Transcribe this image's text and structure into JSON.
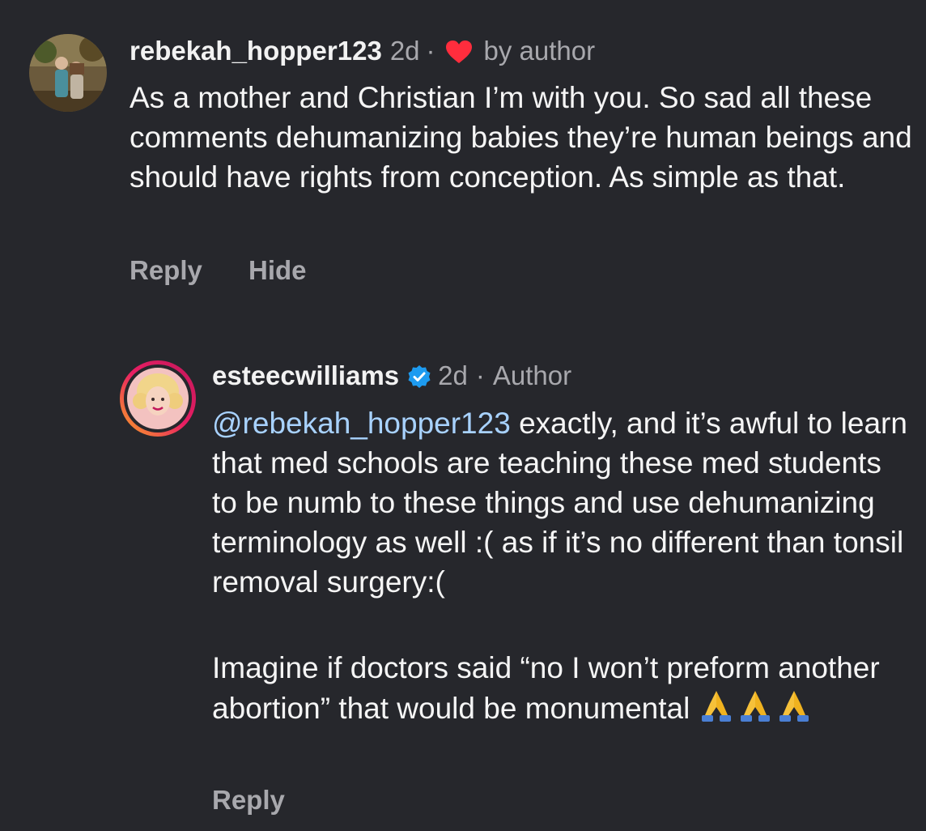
{
  "comment1": {
    "username": "rebekah_hopper123",
    "time": "2d",
    "sep": "·",
    "liked_label": "by author",
    "text": "As a mother and Christian I’m with you. So sad all these comments dehumanizing babies they’re human beings and should have rights from conception. As simple as that.",
    "reply_label": "Reply",
    "hide_label": "Hide"
  },
  "comment2": {
    "username": "esteecwilliams",
    "time": "2d",
    "sep": "·",
    "role": "Author",
    "mention": "@rebekah_hopper123",
    "text_part1": "exactly, and it’s awful to learn that med schools are teaching these med students to be numb to these things and use dehumanizing terminology as well :( as if it’s no different than tonsil removal surgery:(",
    "text_part2": "Imagine if doctors said “no I won’t preform another abortion” that would be monumental",
    "emoji_names": [
      "folded-hands",
      "folded-hands",
      "folded-hands"
    ],
    "reply_label": "Reply"
  },
  "colors": {
    "background": "#26272c",
    "mention": "#a8d2ff",
    "heart": "#ff2d3d",
    "verified": "#1d9bf0",
    "meta": "#a8a8ad"
  }
}
